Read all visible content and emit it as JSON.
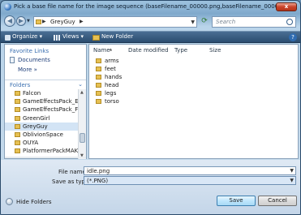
{
  "window": {
    "title": "Pick a base file name for the image sequence (baseFilename_00000.png,baseFilename_00001, etc)",
    "close_glyph": "x"
  },
  "nav": {
    "back_glyph": "◀",
    "forward_glyph": "▶",
    "breadcrumb": [
      "GreyGuy"
    ],
    "search_placeholder": "Search"
  },
  "toolbar": {
    "organize": "Organize ▾",
    "views": "Views ▾",
    "new_folder": "New Folder",
    "help": "?"
  },
  "sidebar": {
    "favorite_links_title": "Favorite Links",
    "favorites": [
      "Documents"
    ],
    "more": "More »",
    "folders_title": "Folders",
    "tree": [
      {
        "label": "Falcon",
        "selected": false
      },
      {
        "label": "GameEffectsPack_Esse",
        "selected": false
      },
      {
        "label": "GameEffectsPack_FULL",
        "selected": false
      },
      {
        "label": "GreenGirl",
        "selected": false
      },
      {
        "label": "GreyGuy",
        "selected": true
      },
      {
        "label": "OblivionSpace",
        "selected": false
      },
      {
        "label": "OUYA",
        "selected": false
      },
      {
        "label": "PlatformerPackMAKE I",
        "selected": false
      }
    ]
  },
  "content": {
    "columns": [
      "Name",
      "Date modified",
      "Type",
      "Size"
    ],
    "items": [
      "arms",
      "feet",
      "hands",
      "head",
      "legs",
      "torso"
    ]
  },
  "form": {
    "file_name_label": "File name:",
    "file_name_value": "idle.png",
    "save_as_type_label": "Save as type:",
    "save_as_type_value": "(*.PNG)",
    "hide_folders": "Hide Folders",
    "save_button": "Save",
    "cancel_button": "Cancel"
  },
  "colors": {
    "toolbar_bg": "#2b4d70",
    "selection": "#d3e4f5",
    "close_button": "#c8432a",
    "folder": "#e6c052"
  }
}
